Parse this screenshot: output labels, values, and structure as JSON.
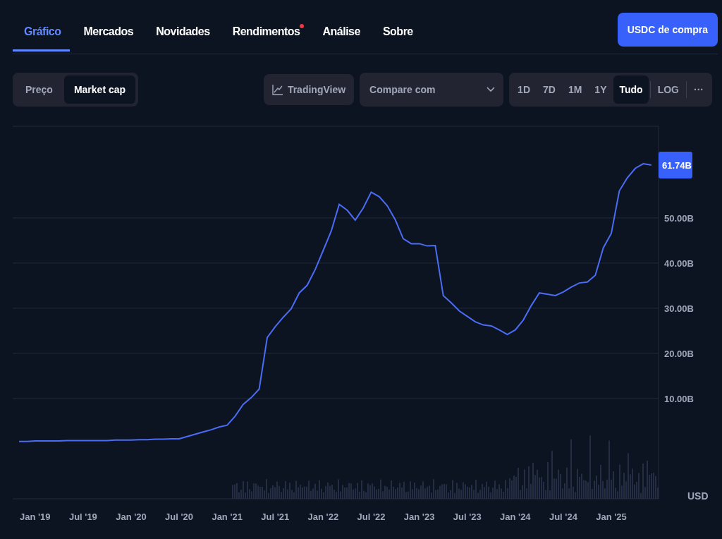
{
  "tabs": [
    {
      "label": "Gráfico",
      "selected": true,
      "dot": false
    },
    {
      "label": "Mercados",
      "selected": false,
      "dot": false
    },
    {
      "label": "Novidades",
      "selected": false,
      "dot": false
    },
    {
      "label": "Rendimentos",
      "selected": false,
      "dot": true
    },
    {
      "label": "Análise",
      "selected": false,
      "dot": false
    },
    {
      "label": "Sobre",
      "selected": false,
      "dot": false
    }
  ],
  "buy_button": "USDC de compra",
  "chart_type": [
    {
      "label": "Preço",
      "selected": false
    },
    {
      "label": "Market cap",
      "selected": true
    }
  ],
  "tradingview_button": "TradingView",
  "compare": {
    "placeholder": "Compare com"
  },
  "ranges": [
    {
      "label": "1D",
      "selected": false
    },
    {
      "label": "7D",
      "selected": false
    },
    {
      "label": "1M",
      "selected": false
    },
    {
      "label": "1Y",
      "selected": false
    },
    {
      "label": "Tudo",
      "selected": true
    }
  ],
  "log_button": "LOG",
  "more_button": "···",
  "chart": {
    "current_value": "61.74B",
    "currency": "USD",
    "chart_data": {
      "type": "line",
      "categories": [
        null,
        null,
        "Jan '19",
        null,
        null,
        null,
        null,
        null,
        "Jul '19",
        null,
        null,
        null,
        null,
        null,
        "Jan '20",
        null,
        null,
        null,
        null,
        null,
        "Jul '20",
        null,
        null,
        null,
        null,
        null,
        "Jan '21",
        null,
        null,
        null,
        null,
        null,
        "Jul '21",
        null,
        null,
        null,
        null,
        null,
        "Jan '22",
        null,
        null,
        null,
        null,
        null,
        "Jul '22",
        null,
        null,
        null,
        null,
        null,
        "Jan '23",
        null,
        null,
        null,
        null,
        null,
        "Jul '23",
        null,
        null,
        null,
        null,
        null,
        "Jan '24",
        null,
        null,
        null,
        null,
        null,
        "Jul '24",
        null,
        null,
        null,
        null,
        null,
        "Jan '25",
        null,
        null,
        null,
        null,
        null
      ],
      "series": [
        {
          "color": "#4b6cf5",
          "values": [
            0.5,
            0.5,
            0.6,
            0.6,
            0.6,
            0.6,
            0.7,
            0.7,
            0.7,
            0.7,
            0.7,
            0.7,
            0.8,
            0.8,
            0.8,
            0.9,
            0.9,
            1.0,
            1.0,
            1.1,
            1.1,
            1.6,
            2.1,
            2.6,
            3.1,
            3.7,
            4.1,
            6.1,
            8.7,
            10.2,
            12.1,
            23.5,
            25.9,
            28,
            29.9,
            33.4,
            35.1,
            38.6,
            42.8,
            47.1,
            53,
            51.7,
            49.5,
            52.2,
            55.7,
            54.7,
            52.7,
            49.6,
            45.4,
            44.3,
            44.3,
            43.8,
            43.9,
            32.8,
            31.2,
            29.4,
            28.2,
            27,
            26.3,
            26.1,
            25.2,
            24.2,
            25.2,
            27.4,
            30.6,
            33.4,
            33.1,
            32.8,
            33.6,
            34.7,
            35.6,
            35.8,
            37.3,
            43.4,
            46.6,
            56,
            58.9,
            61,
            62,
            61.7
          ]
        }
      ],
      "grid": true,
      "ylim": [
        -12.2,
        70.3
      ],
      "yticks": [
        {
          "value": 10,
          "label": "10.00B"
        },
        {
          "value": 20,
          "label": "20.00B"
        },
        {
          "value": 30,
          "label": "30.00B"
        },
        {
          "value": 40,
          "label": "40.00B"
        },
        {
          "value": 50,
          "label": "50.00B"
        }
      ]
    }
  }
}
